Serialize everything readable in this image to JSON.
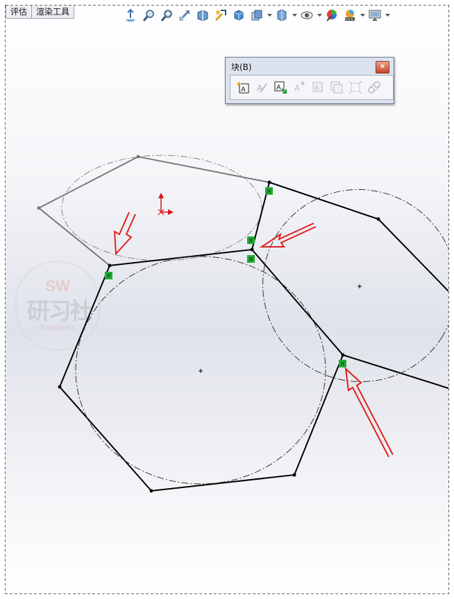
{
  "tabs": [
    {
      "label": "评估"
    },
    {
      "label": "渲染工具"
    }
  ],
  "heads_up_toolbar": {
    "icons": [
      "normal-to-icon",
      "zoom-to-fit-icon",
      "zoom-area-icon",
      "previous-view-icon",
      "section-view-icon",
      "dynamic-annotation-icon",
      "view-orientation-icon",
      "display-style-icon",
      "hide-show-items-icon",
      "edit-appearance-icon",
      "apply-scene-icon",
      "view-settings-icon"
    ]
  },
  "block_toolbar": {
    "title": "块(B)",
    "close_label": "×",
    "buttons": [
      {
        "icon": "make-block-icon",
        "enabled": true
      },
      {
        "icon": "edit-block-icon",
        "enabled": false
      },
      {
        "icon": "insert-block-icon",
        "enabled": true
      },
      {
        "icon": "add-remove-entities-icon",
        "enabled": false
      },
      {
        "icon": "rebuild-block-icon",
        "enabled": false
      },
      {
        "icon": "save-block-icon",
        "enabled": false
      },
      {
        "icon": "explode-block-icon",
        "enabled": false
      },
      {
        "icon": "belt-chain-icon",
        "enabled": false
      }
    ]
  },
  "watermark": {
    "line1": "SW",
    "line2": "研习社",
    "line3": "SolidWorks"
  },
  "colors": {
    "sketch_fixed": "#000000",
    "sketch_gray": "#7a7a7a",
    "relation_marker": "#22aa33",
    "arrow": "#e02020",
    "origin": "#dd1111"
  }
}
